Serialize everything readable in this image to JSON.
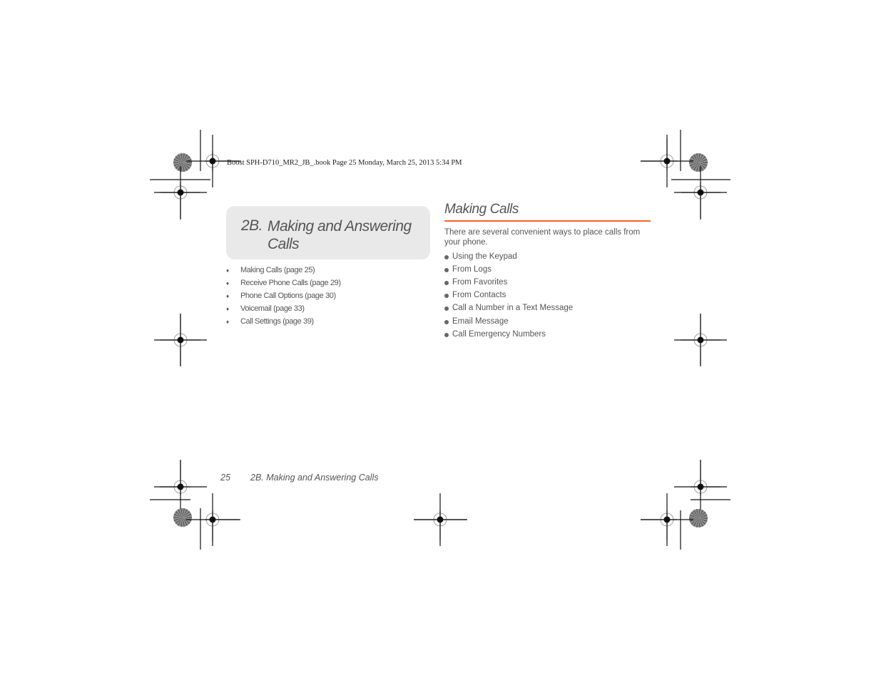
{
  "slug": "Boost SPH-D710_MR2_JB_.book  Page 25  Monday, March 25, 2013  5:34 PM",
  "chapter": {
    "number": "2B.",
    "title": "Making and Answering Calls"
  },
  "toc": [
    {
      "label": "Making Calls (page 25)"
    },
    {
      "label": "Receive Phone Calls (page 29)"
    },
    {
      "label": "Phone Call Options (page 30)"
    },
    {
      "label": "Voicemail (page 33)"
    },
    {
      "label": "Call Settings (page 39)"
    }
  ],
  "toc_bullet": "♦",
  "section": {
    "title": "Making Calls",
    "intro": "There are several convenient ways to place calls from your phone.",
    "items": [
      {
        "label": "Using the Keypad"
      },
      {
        "label": "From Logs"
      },
      {
        "label": "From Favorites"
      },
      {
        "label": "From Contacts"
      },
      {
        "label": "Call a Number in a Text Message"
      },
      {
        "label": "Email Message"
      },
      {
        "label": "Call Emergency Numbers"
      }
    ]
  },
  "footer": {
    "page_number": "25",
    "running_title": "2B. Making and Answering Calls"
  },
  "colors": {
    "accent_rule": "#f26522",
    "chapter_box": "#e9e9e9",
    "text": "#555555"
  }
}
